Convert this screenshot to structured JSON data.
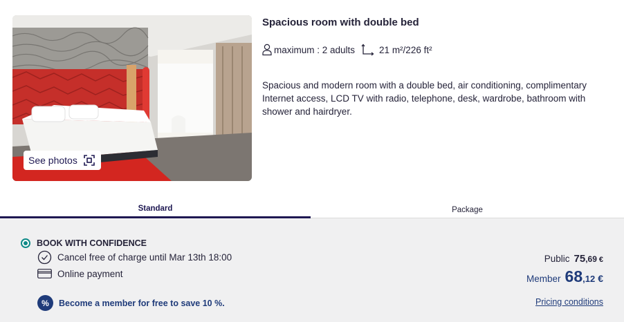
{
  "room": {
    "title": "Spacious room with double bed",
    "capacity": "maximum : 2 adults",
    "area": "21 m²/226 ft²",
    "description": "Spacious and modern room with a double bed, air conditioning, complimentary Internet access, LCD TV with radio, telephone, desk, wardrobe, bathroom with shower and hairdryer.",
    "see_photos_label": "See photos"
  },
  "tabs": [
    {
      "label": "Standard",
      "active": true
    },
    {
      "label": "Package",
      "active": false
    }
  ],
  "offer": {
    "title": "BOOK WITH CONFIDENCE",
    "cancel_text": "Cancel free of charge until Mar 13th 18:00",
    "payment_text": "Online payment",
    "member_promo": "Become a member for free to save 10 %.",
    "member_promo_icon": "%",
    "public_label": "Public",
    "public_price_int": "75",
    "public_price_dec": ",69",
    "public_currency": "€",
    "member_label": "Member",
    "member_price_int": "68",
    "member_price_dec": ",12",
    "member_currency": "€",
    "pricing_link": "Pricing conditions"
  },
  "colors": {
    "brand_navy": "#1e1852",
    "link_blue": "#1f3b7a",
    "radio_teal": "#0f8a88",
    "offer_bg": "#f0f0f1"
  },
  "icons": [
    "person-icon",
    "area-icon",
    "gallery-icon",
    "clock-icon",
    "credit-card-icon",
    "percent-icon"
  ]
}
